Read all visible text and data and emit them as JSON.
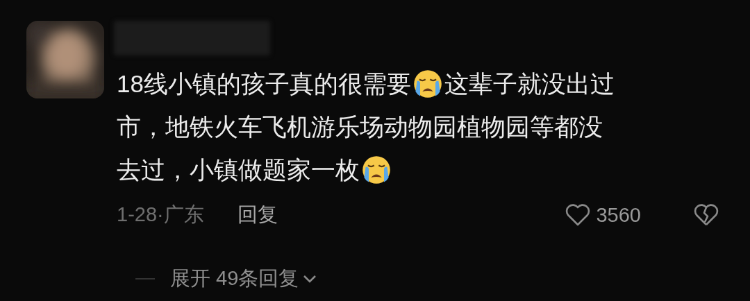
{
  "comment": {
    "avatar": {
      "kind": "picture"
    },
    "lines": [
      [
        {
          "kind": "text",
          "text": "18线小镇的孩子真的很需要"
        },
        {
          "kind": "emoji"
        },
        {
          "kind": "text",
          "text": "这辈子就没出过"
        }
      ],
      [
        {
          "kind": "text",
          "text": "市，地铁火车飞机游乐场动物园植物园等都没"
        }
      ],
      [
        {
          "kind": "text",
          "text": "去过，小镇做题家一枚"
        },
        {
          "kind": "emoji"
        }
      ]
    ],
    "date_location": "1-28·广东",
    "reply": "回复",
    "likes": "3560"
  },
  "expand_replies": "展开 49条回复"
}
